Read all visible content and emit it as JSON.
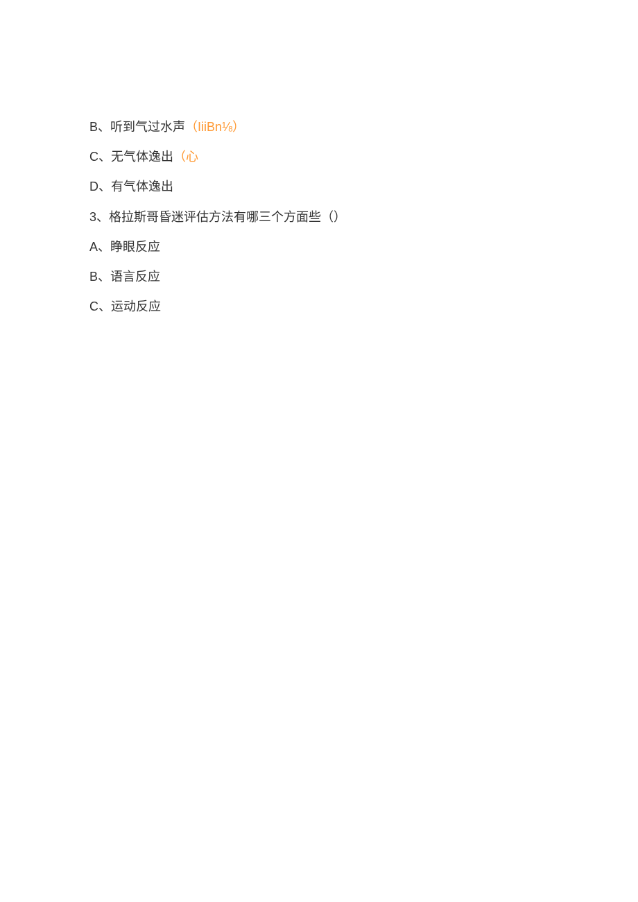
{
  "lines": {
    "b": {
      "label": "B",
      "sep": "、",
      "text": "听到气过水声",
      "note_open": "（",
      "note": "IiiBn⅛",
      "note_close": "）"
    },
    "c": {
      "label": "C",
      "sep": "、",
      "text": "无气体逸出",
      "note_open": "（",
      "note": "心"
    },
    "d": {
      "label": "D",
      "sep": "、",
      "text": "有气体逸出"
    },
    "q3": {
      "num": "3",
      "sep": "、",
      "text": "格拉斯哥昏迷评估方法有哪三个方面些（）"
    },
    "a3a": {
      "label": "A",
      "sep": "、",
      "text": "睁眼反应"
    },
    "a3b": {
      "label": "B",
      "sep": "、",
      "text": "语言反应"
    },
    "a3c": {
      "label": "C",
      "sep": "、",
      "text": "运动反应"
    }
  }
}
